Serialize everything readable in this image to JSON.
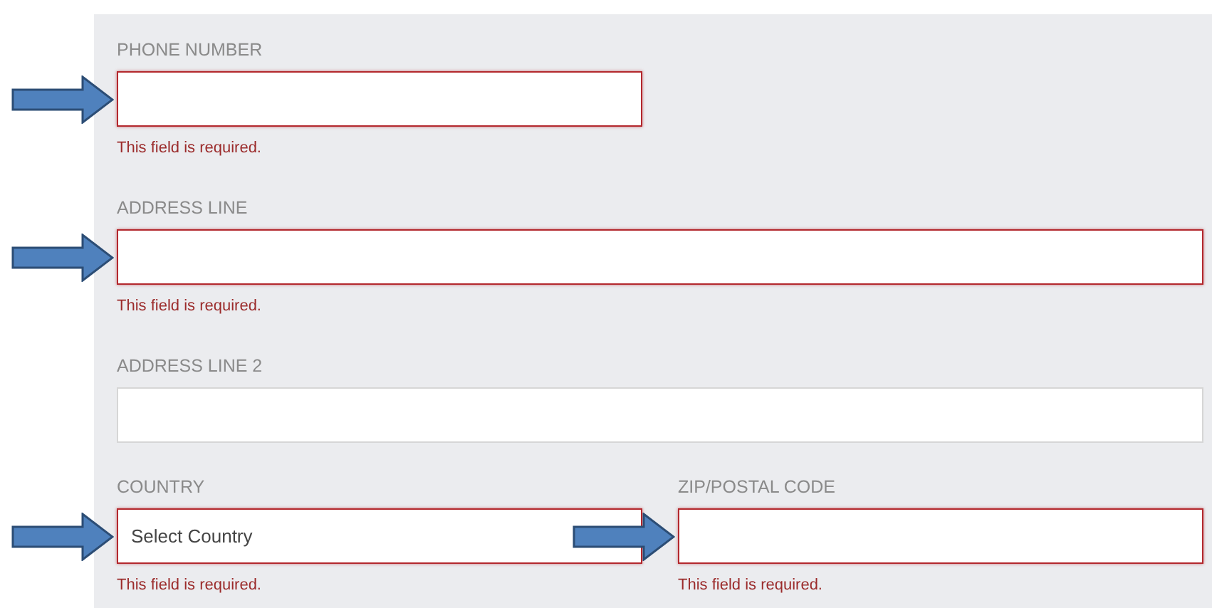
{
  "rows": [
    {
      "fields": [
        {
          "kind": "short-text",
          "label": "PHONE NUMBER",
          "invalid": true,
          "error": "This field is required.",
          "arrow": true
        }
      ]
    },
    {
      "fields": [
        {
          "kind": "text",
          "label": "ADDRESS LINE",
          "invalid": true,
          "error": "This field is required.",
          "arrow": true
        }
      ]
    },
    {
      "fields": [
        {
          "kind": "text",
          "label": "ADDRESS LINE 2",
          "invalid": false
        }
      ]
    },
    {
      "fields": [
        {
          "kind": "select",
          "label": "COUNTRY",
          "value": "Select Country",
          "invalid": true,
          "error": "This field is required.",
          "arrow": true
        },
        {
          "kind": "text",
          "label": "ZIP/POSTAL CODE",
          "invalid": true,
          "error": "This field is required.",
          "arrow": true
        }
      ]
    }
  ]
}
